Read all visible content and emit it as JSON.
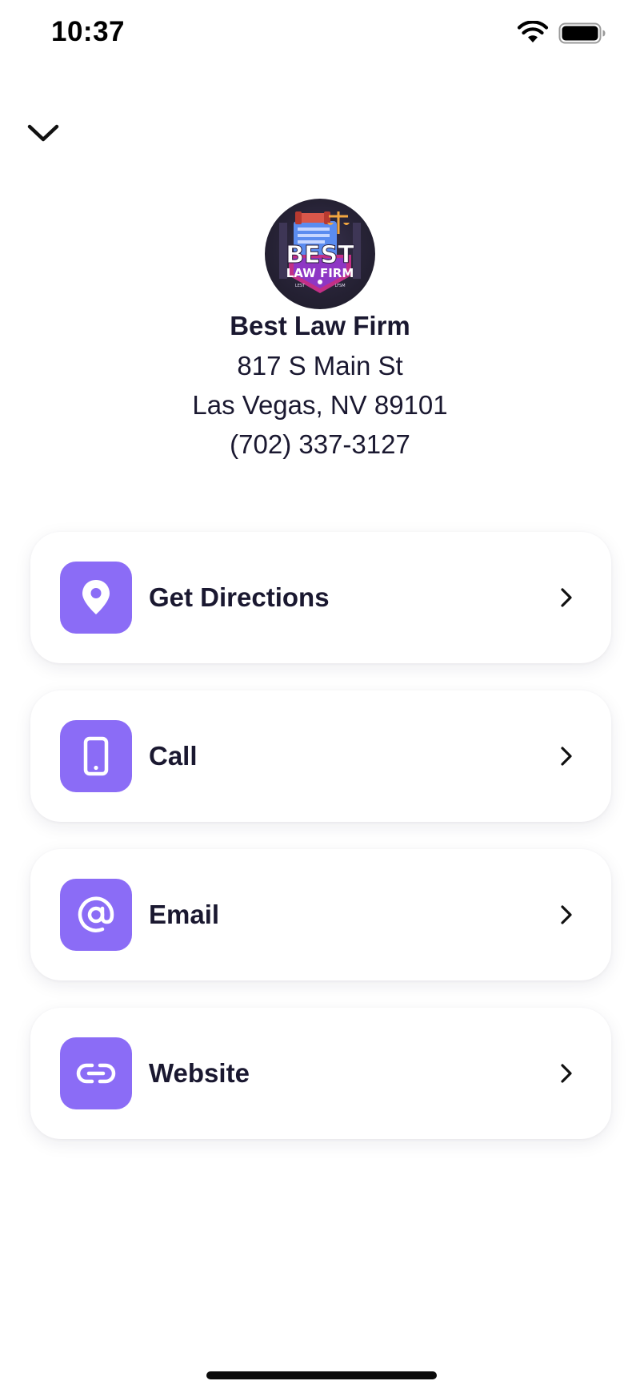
{
  "status_bar": {
    "time": "10:37",
    "icons": [
      "wifi-icon",
      "battery-icon"
    ]
  },
  "header": {
    "dismiss_icon": "chevron-down-icon",
    "logo_text": {
      "line1": "BEST",
      "line2": "LAW FIRM",
      "small_left": "LEST",
      "small_right": "LFSM"
    },
    "firm_name": "Best Law Firm",
    "address_line1": "817 S Main St",
    "address_line2": "Las Vegas, NV 89101",
    "phone": "(702) 337-3127"
  },
  "actions": [
    {
      "label": "Get Directions",
      "icon": "location-pin-icon"
    },
    {
      "label": "Call",
      "icon": "smartphone-icon"
    },
    {
      "label": "Email",
      "icon": "at-sign-icon"
    },
    {
      "label": "Website",
      "icon": "link-icon"
    }
  ],
  "colors": {
    "accent": "#8b6cf6",
    "text_primary": "#1a1830",
    "background": "#ffffff"
  }
}
